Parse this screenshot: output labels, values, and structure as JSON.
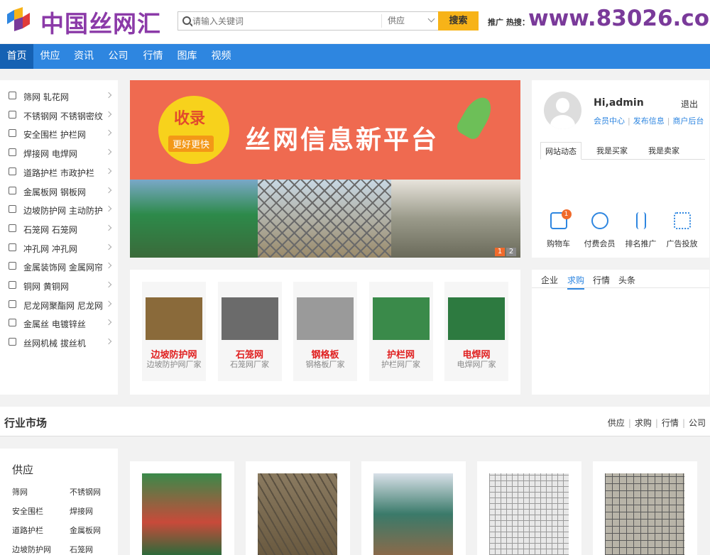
{
  "header": {
    "site_name": "中国丝网汇",
    "search_placeholder": "请输入关键词",
    "search_type": "供应",
    "search_button": "搜索",
    "hot_label": "推广 热搜：",
    "promo_url": "www.83026.com"
  },
  "nav": [
    "首页",
    "供应",
    "资讯",
    "公司",
    "行情",
    "图库",
    "视频"
  ],
  "categories": [
    {
      "label": "筛网 轧花网",
      "icon": "sieve-icon"
    },
    {
      "label": "不锈钢网 不锈钢密纹",
      "icon": "building-icon"
    },
    {
      "label": "安全围栏 护栏网",
      "icon": "grid-icon"
    },
    {
      "label": "焊接网 电焊网",
      "icon": "camera-icon"
    },
    {
      "label": "道路护栏 市政护栏",
      "icon": "bulb-icon"
    },
    {
      "label": "金属板网 钢板网",
      "icon": "wrench-icon"
    },
    {
      "label": "边坡防护网 主动防护",
      "icon": "power-icon"
    },
    {
      "label": "石笼网 石笼网",
      "icon": "drop-icon"
    },
    {
      "label": "冲孔网 冲孔网",
      "icon": "cup-icon"
    },
    {
      "label": "金属装饰网 金属网帘",
      "icon": "shirt-icon"
    },
    {
      "label": "铜网 黄铜网",
      "icon": "gear-icon"
    },
    {
      "label": "尼龙网聚酯网 尼龙网",
      "icon": "chip-icon"
    },
    {
      "label": "金属丝 电镀锌丝",
      "icon": "cart-icon"
    },
    {
      "label": "丝网机械 拔丝机",
      "icon": "stairs-icon"
    }
  ],
  "banner": {
    "tag_top": "收录",
    "tag_bottom": "更好更快",
    "headline": "丝网信息新平台",
    "pages": [
      "1",
      "2"
    ]
  },
  "user": {
    "greeting": "Hi,admin",
    "logout": "退出",
    "links": [
      "会员中心",
      "发布信息",
      "商户后台"
    ],
    "tabs": [
      "网站动态",
      "我是买家",
      "我是卖家"
    ],
    "actions": [
      {
        "label": "购物车",
        "icon": "cart-icon",
        "badge": "1"
      },
      {
        "label": "付费会员",
        "icon": "vip-icon"
      },
      {
        "label": "排名推广",
        "icon": "sort-icon"
      },
      {
        "label": "广告投放",
        "icon": "apps-icon"
      }
    ]
  },
  "products": [
    {
      "name": "边坡防护网",
      "sub": "边坡防护网厂家",
      "color": "#8a6a3a"
    },
    {
      "name": "石笼网",
      "sub": "石笼网厂家",
      "color": "#6b6b6b"
    },
    {
      "name": "钢格板",
      "sub": "钢格板厂家",
      "color": "#9a9a9a"
    },
    {
      "name": "护栏网",
      "sub": "护栏网厂家",
      "color": "#3a8a4a"
    },
    {
      "name": "电焊网",
      "sub": "电焊网厂家",
      "color": "#2d7a40"
    }
  ],
  "news_tabs": [
    "企业",
    "求购",
    "行情",
    "头条"
  ],
  "market": {
    "title": "行业市场",
    "links": [
      "供应",
      "求购",
      "行情",
      "公司"
    ]
  },
  "supply": {
    "title": "供应",
    "items": [
      "筛网",
      "不锈钢网",
      "安全围栏",
      "焊接网",
      "道路护栏",
      "金属板网",
      "边坡防护网",
      "石笼网"
    ]
  },
  "colors": {
    "nav_bg": "#2e86e0",
    "nav_active": "#1561b3",
    "search_btn": "#f7b318",
    "banner_bg": "#ef6a50",
    "product_name": "#e02020"
  }
}
